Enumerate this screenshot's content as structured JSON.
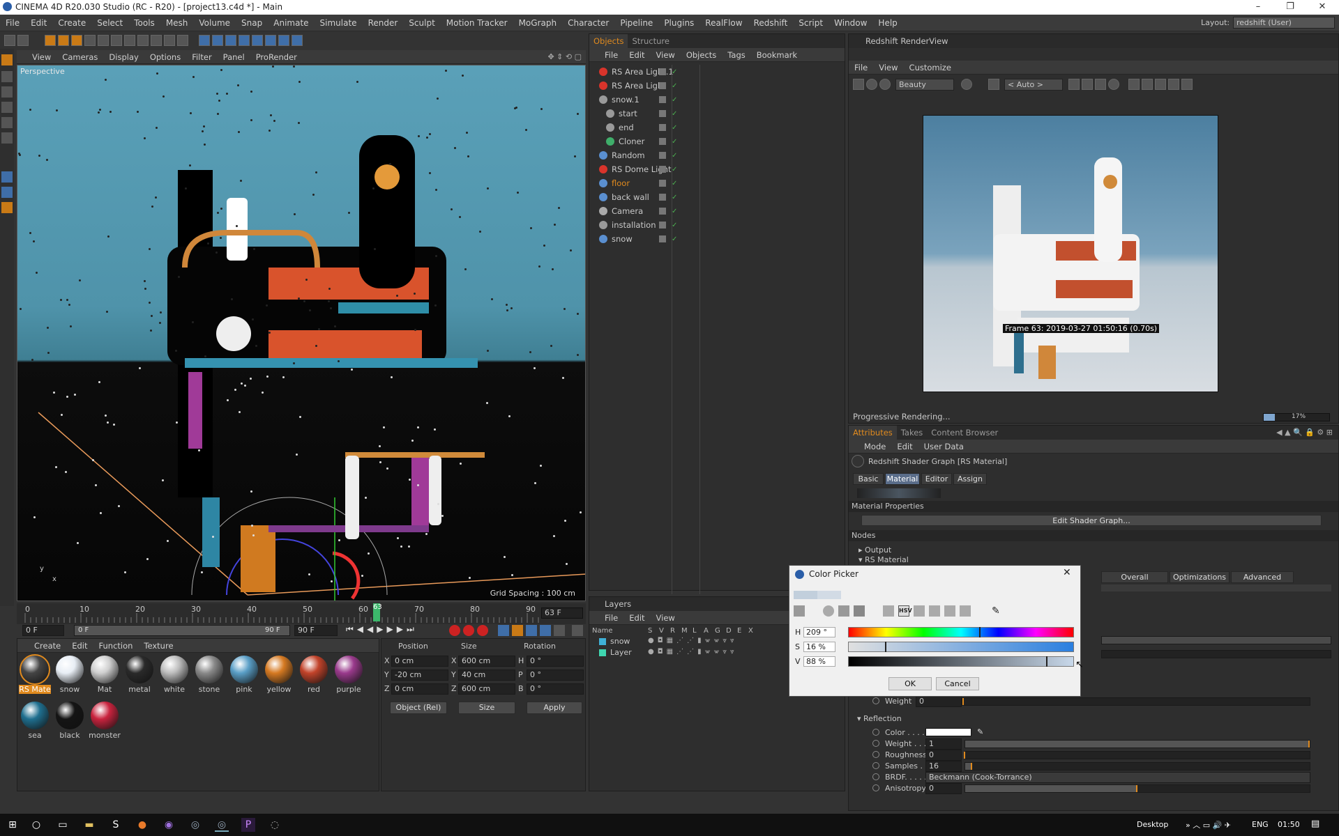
{
  "window": {
    "title": "CINEMA 4D R20.030 Studio (RC - R20) - [project13.c4d *] - Main",
    "min": "–",
    "max": "❐",
    "close": "✕"
  },
  "menu": [
    "File",
    "Edit",
    "Create",
    "Select",
    "Tools",
    "Mesh",
    "Volume",
    "Snap",
    "Animate",
    "Simulate",
    "Render",
    "Sculpt",
    "Motion Tracker",
    "MoGraph",
    "Character",
    "Pipeline",
    "Plugins",
    "RealFlow",
    "Redshift",
    "Script",
    "Window",
    "Help"
  ],
  "layout": {
    "label": "Layout:",
    "value": "redshift (User)"
  },
  "viewport": {
    "menu": [
      "View",
      "Cameras",
      "Display",
      "Options",
      "Filter",
      "Panel",
      "ProRender"
    ],
    "label": "Perspective",
    "grid_spacing": "Grid Spacing : 100 cm"
  },
  "timeline": {
    "ticks": [
      "0",
      "10",
      "20",
      "30",
      "40",
      "50",
      "60",
      "70",
      "80",
      "90"
    ],
    "current_frame_marker": "63",
    "current_frame": "63 F",
    "start_field": "0 F",
    "range_start": "0 F",
    "range_end": "90 F",
    "end_field": "90 F",
    "current_fraction": 0.7
  },
  "objects": {
    "tabs": [
      "Objects",
      "Structure"
    ],
    "menu": [
      "File",
      "Edit",
      "View",
      "Objects",
      "Tags",
      "Bookmark"
    ],
    "items": [
      {
        "name": "RS Area Light.1",
        "color": "#d9342b",
        "indent": 0
      },
      {
        "name": "RS Area Light",
        "color": "#d9342b",
        "indent": 0
      },
      {
        "name": "snow.1",
        "color": "#9a9a9a",
        "indent": 0
      },
      {
        "name": "start",
        "color": "#9a9a9a",
        "indent": 1
      },
      {
        "name": "end",
        "color": "#9a9a9a",
        "indent": 1
      },
      {
        "name": "Cloner",
        "color": "#3fae6a",
        "indent": 1
      },
      {
        "name": "Random",
        "color": "#5a8fd0",
        "indent": 0
      },
      {
        "name": "RS Dome Light",
        "color": "#d9342b",
        "indent": 0
      },
      {
        "name": "floor",
        "color": "#5a8fd0",
        "indent": 0
      },
      {
        "name": "back wall",
        "color": "#5a8fd0",
        "indent": 0
      },
      {
        "name": "Camera",
        "color": "#aaaaaa",
        "indent": 0
      },
      {
        "name": "installation",
        "color": "#9a9a9a",
        "indent": 0
      },
      {
        "name": "snow",
        "color": "#5a8fd0",
        "indent": 0
      }
    ],
    "floor_color": "#e08a1e"
  },
  "materials": {
    "menu": [
      "Create",
      "Edit",
      "Function",
      "Texture"
    ],
    "items": [
      {
        "name": "RS Mate",
        "color": "#444444",
        "selected": true
      },
      {
        "name": "snow",
        "color": "#e8eef5"
      },
      {
        "name": "Mat",
        "color": "#cfcfcf"
      },
      {
        "name": "metal",
        "color": "#2a2a2a"
      },
      {
        "name": "white",
        "color": "#bdbdbd"
      },
      {
        "name": "stone",
        "color": "#8a8a8a"
      },
      {
        "name": "pink",
        "color": "#5a9fc7"
      },
      {
        "name": "yellow",
        "color": "#d67a22"
      },
      {
        "name": "red",
        "color": "#c2432a"
      },
      {
        "name": "purple",
        "color": "#9a3a8c"
      },
      {
        "name": "sea",
        "color": "#1f6f8f"
      },
      {
        "name": "black",
        "color": "#141414"
      },
      {
        "name": "monster",
        "color": "#c9233e"
      }
    ]
  },
  "coords": {
    "headers": [
      "Position",
      "Size",
      "Rotation"
    ],
    "rows": [
      {
        "axis": "X",
        "pos": "0 cm",
        "saxis": "X",
        "size": "600 cm",
        "raxis": "H",
        "rot": "0 °"
      },
      {
        "axis": "Y",
        "pos": "-20 cm",
        "saxis": "Y",
        "size": "40 cm",
        "raxis": "P",
        "rot": "0 °"
      },
      {
        "axis": "Z",
        "pos": "0 cm",
        "saxis": "Z",
        "size": "600 cm",
        "raxis": "B",
        "rot": "0 °"
      }
    ],
    "mode": "Object (Rel)",
    "size_mode": "Size",
    "apply": "Apply"
  },
  "layers": {
    "title": "Layers",
    "menu": [
      "File",
      "Edit",
      "View"
    ],
    "headers": [
      "Name",
      "S",
      "V",
      "R",
      "M",
      "L",
      "A",
      "G",
      "D",
      "E",
      "X"
    ],
    "items": [
      {
        "name": "snow",
        "color": "#3fb0d6"
      },
      {
        "name": "Layer",
        "color": "#3fd6b0"
      }
    ]
  },
  "renderview": {
    "title": "Redshift RenderView",
    "menu": [
      "File",
      "View",
      "Customize"
    ],
    "aov": "Beauty",
    "camera": "< Auto >",
    "frame_info": "Frame  63:  2019-03-27  01:50:16  (0.70s)",
    "status": "Progressive Rendering...",
    "progress_label": "17%",
    "progress": 0.17
  },
  "attributes": {
    "tabs": [
      "Attributes",
      "Takes",
      "Content Browser"
    ],
    "menu": [
      "Mode",
      "Edit",
      "User Data"
    ],
    "object": "Redshift Shader Graph [RS Material]",
    "subtabs": [
      "Basic",
      "Material",
      "Editor",
      "Assign"
    ],
    "section": "Material Properties",
    "edit_graph": "Edit Shader Graph...",
    "nodes": "Nodes",
    "output": "Output",
    "rs_material": "RS Material",
    "mat_tabs": [
      "Overall",
      "Optimizations",
      "Advanced"
    ],
    "weight_label": "Weight",
    "weight_value": "0",
    "reflection": "Reflection",
    "refl_rows": [
      {
        "label": "Color . . . .",
        "type": "color",
        "color": "#ffffff"
      },
      {
        "label": "Weight . . . .",
        "value": "1",
        "fraction": 1.0
      },
      {
        "label": "Roughness",
        "value": "0",
        "fraction": 0.0
      },
      {
        "label": "Samples . .",
        "value": "16",
        "fraction": 0.02
      },
      {
        "label": "BRDF. . . . .",
        "value": "Beckmann (Cook-Torrance)",
        "type": "select"
      },
      {
        "label": "Anisotropy",
        "value": "0",
        "fraction": 0.5
      }
    ]
  },
  "color_picker": {
    "title": "Color Picker",
    "close": "✕",
    "mode_label": "HSV",
    "h_label": "H",
    "h_value": "209 °",
    "h_fraction": 0.58,
    "s_label": "S",
    "s_value": "16 %",
    "s_fraction": 0.16,
    "v_label": "V",
    "v_value": "88 %",
    "v_fraction": 0.88,
    "swatch": "#c2cfdc",
    "ok": "OK",
    "cancel": "Cancel"
  },
  "taskbar": {
    "desktop": "Desktop",
    "lang": "ENG",
    "time": "01:50"
  }
}
